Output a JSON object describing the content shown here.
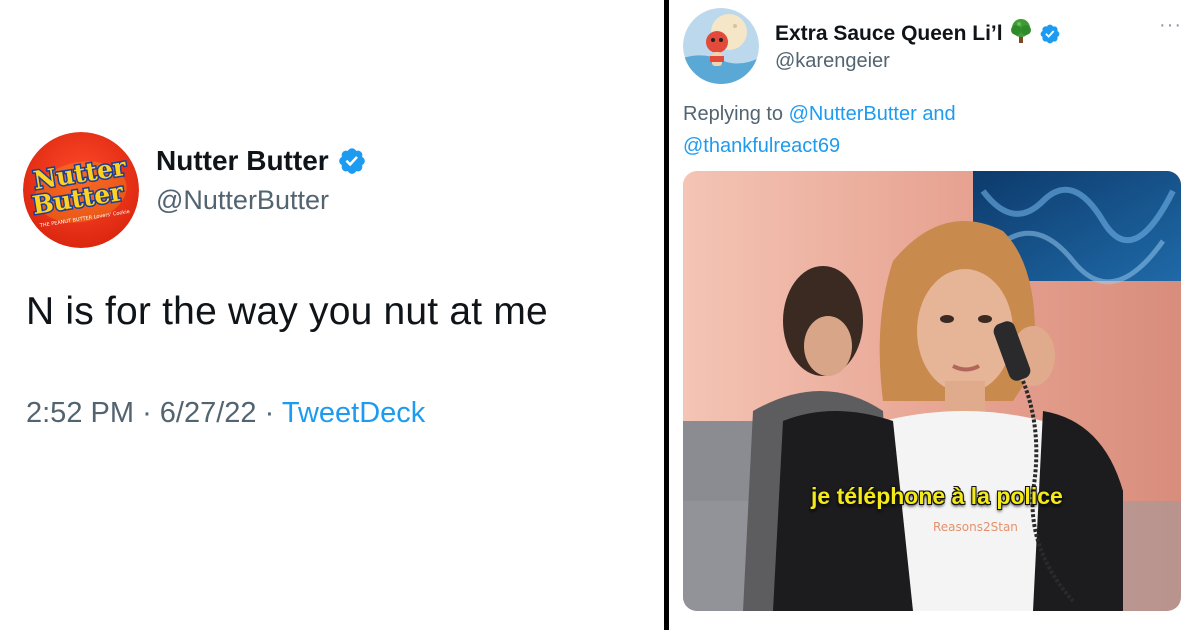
{
  "left_tweet": {
    "avatar_logo_line1": "Nutter",
    "avatar_logo_line2": "Butter",
    "avatar_logo_tag": "THE PEANUT BUTTER Lovers' Cookie",
    "name": "Nutter Butter",
    "handle": "@NutterButter",
    "text": "N is for the way you nut at me",
    "time": "2:52 PM",
    "separator": "·",
    "date": "6/27/22",
    "source": "TweetDeck"
  },
  "right_tweet": {
    "name": "Extra Sauce Queen Li’l",
    "name_emoji": "🌳",
    "handle": "@karengeier",
    "more_label": "···",
    "reply_prefix": "Replying to",
    "reply_mention_1": "@NutterButter",
    "reply_and": "and",
    "reply_mention_2": "@thankfulreact69",
    "media_caption": "je téléphone à la police",
    "media_watermark": "Reasons2Stan"
  },
  "colors": {
    "link": "#1d9bf0",
    "secondary_text": "#536471",
    "caption_yellow": "#f4ea1a"
  },
  "icons": [
    "verified-badge-icon",
    "tree-emoji-icon",
    "more-options-icon"
  ]
}
